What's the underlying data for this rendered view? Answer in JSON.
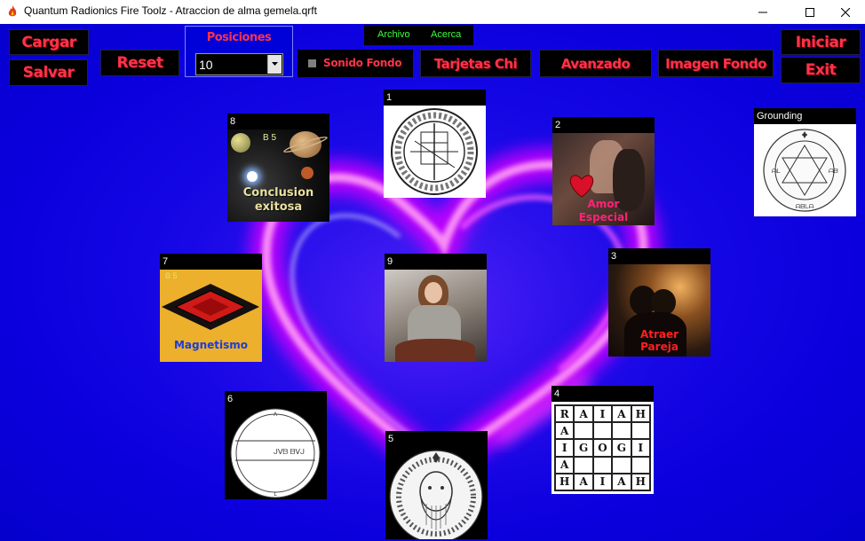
{
  "window": {
    "title": "Quantum Radionics Fire Toolz - Atraccion de alma gemela.qrft",
    "icons": [
      "flame-icon",
      "minimize-icon",
      "maximize-icon",
      "close-icon"
    ]
  },
  "menu": {
    "archivo": "Archivo",
    "acerca": "Acerca"
  },
  "buttons": {
    "cargar": "Cargar",
    "salvar": "Salvar",
    "reset": "Reset",
    "tarjetas": "Tarjetas Chi",
    "avanzado": "Avanzado",
    "imagen_fondo": "Imagen Fondo",
    "iniciar": "Iniciar",
    "exit": "Exit"
  },
  "positions": {
    "label": "Posiciones",
    "value": "10"
  },
  "sound": {
    "label": "Sonido Fondo",
    "checked": false
  },
  "grounding": {
    "label": "Grounding"
  },
  "cards": [
    {
      "num": "1",
      "caption": ""
    },
    {
      "num": "2",
      "caption": "Amor Especial",
      "caption_lines": [
        "Amor",
        "Especial"
      ]
    },
    {
      "num": "3",
      "caption": "Atraer Pareja",
      "caption_lines": [
        "Atraer",
        "Pareja"
      ]
    },
    {
      "num": "4",
      "caption": ""
    },
    {
      "num": "5",
      "caption": ""
    },
    {
      "num": "6",
      "caption": ""
    },
    {
      "num": "7",
      "caption": "Magnetismo",
      "badge": "B 5"
    },
    {
      "num": "8",
      "caption": "Conclusion exitosa",
      "caption_lines": [
        "Conclusion",
        "exitosa"
      ],
      "badge": "B 5"
    },
    {
      "num": "9",
      "caption": ""
    }
  ],
  "grid_letters": [
    [
      "R",
      "A",
      "I",
      "A",
      "H"
    ],
    [
      "A",
      "",
      "",
      "",
      ""
    ],
    [
      "I",
      "G",
      "O",
      "G",
      "I"
    ],
    [
      "A",
      "",
      "",
      "",
      ""
    ],
    [
      "H",
      "A",
      "I",
      "A",
      "H"
    ]
  ],
  "colors": {
    "background": "#0500d8",
    "button_text": "#ff3347",
    "menu_text": "#3cff3c",
    "caption_pink": "#ff2277",
    "caption_red": "#ff2020",
    "caption_blue": "#1a3cdd"
  }
}
